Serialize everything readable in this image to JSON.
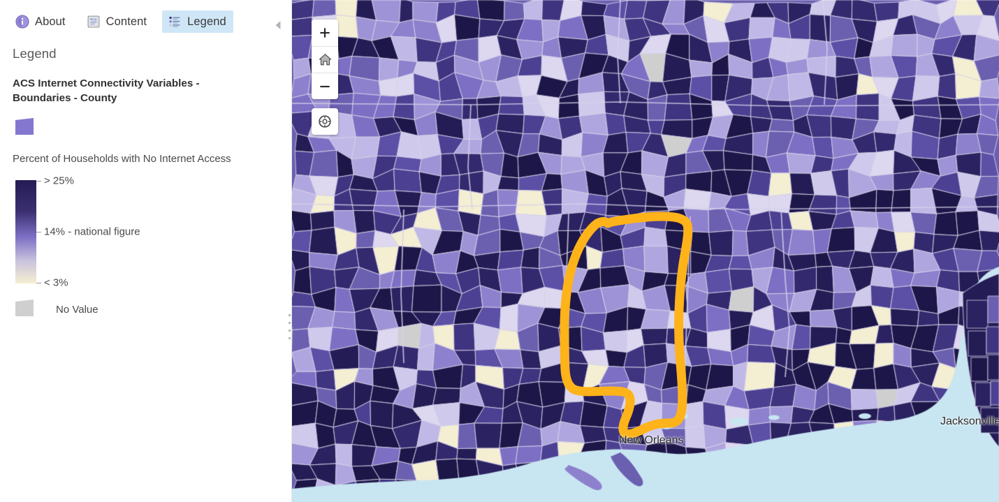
{
  "sidebar": {
    "tabs": [
      {
        "id": "about",
        "label": "About",
        "icon": "info-circle-icon",
        "active": false
      },
      {
        "id": "content",
        "label": "Content",
        "icon": "content-list-icon",
        "active": false
      },
      {
        "id": "legend",
        "label": "Legend",
        "icon": "legend-icon",
        "active": true
      }
    ],
    "collapse_icon": "collapse-left-triangle-icon",
    "panel_title": "Legend",
    "layer_title": "ACS Internet Connectivity Variables - Boundaries - County",
    "layer_swatch_color": "#8377cf",
    "ramp_title": "Percent of Households with No Internet Access",
    "ramp_stops": [
      {
        "position": 0,
        "color": "#241c55"
      },
      {
        "position": 0.3,
        "color": "#3b2f70"
      },
      {
        "position": 0.55,
        "color": "#7d6fc4"
      },
      {
        "position": 0.78,
        "color": "#c9c2dd"
      },
      {
        "position": 1,
        "color": "#f4efd2"
      }
    ],
    "ramp_labels": [
      {
        "value": "> 25%",
        "position": 0.0
      },
      {
        "value": "14% - national figure",
        "position": 0.5
      },
      {
        "value": "< 3%",
        "position": 1.0
      }
    ],
    "no_value": {
      "label": "No Value",
      "color": "#cfcfcf"
    },
    "resize_handle": "sidebar-resize-grip"
  },
  "map": {
    "controls": [
      {
        "id": "zoom-in",
        "icon": "plus-icon",
        "title": "Zoom in"
      },
      {
        "id": "home",
        "icon": "home-icon",
        "title": "Default extent"
      },
      {
        "id": "zoom-out",
        "icon": "minus-icon",
        "title": "Zoom out"
      },
      {
        "id": "locate",
        "icon": "locate-crosshair-icon",
        "title": "Find my location"
      }
    ],
    "labels": [
      {
        "id": "new-orleans",
        "text": "New Orleans"
      },
      {
        "id": "jacksonville",
        "text": "Jacksonville"
      }
    ],
    "annotation": {
      "name": "mississippi-highlight-outline",
      "color": "#FFB31A",
      "stroke_width": 13
    },
    "colors": {
      "ocean": "#c8e6f2",
      "county_dark": "#241c55",
      "county_mid": "#6b5fb0",
      "county_light": "#b9b0e0",
      "county_pale": "#f4efd2",
      "no_data": "#cfcfcf",
      "boundary": "#d8d4ea"
    }
  }
}
